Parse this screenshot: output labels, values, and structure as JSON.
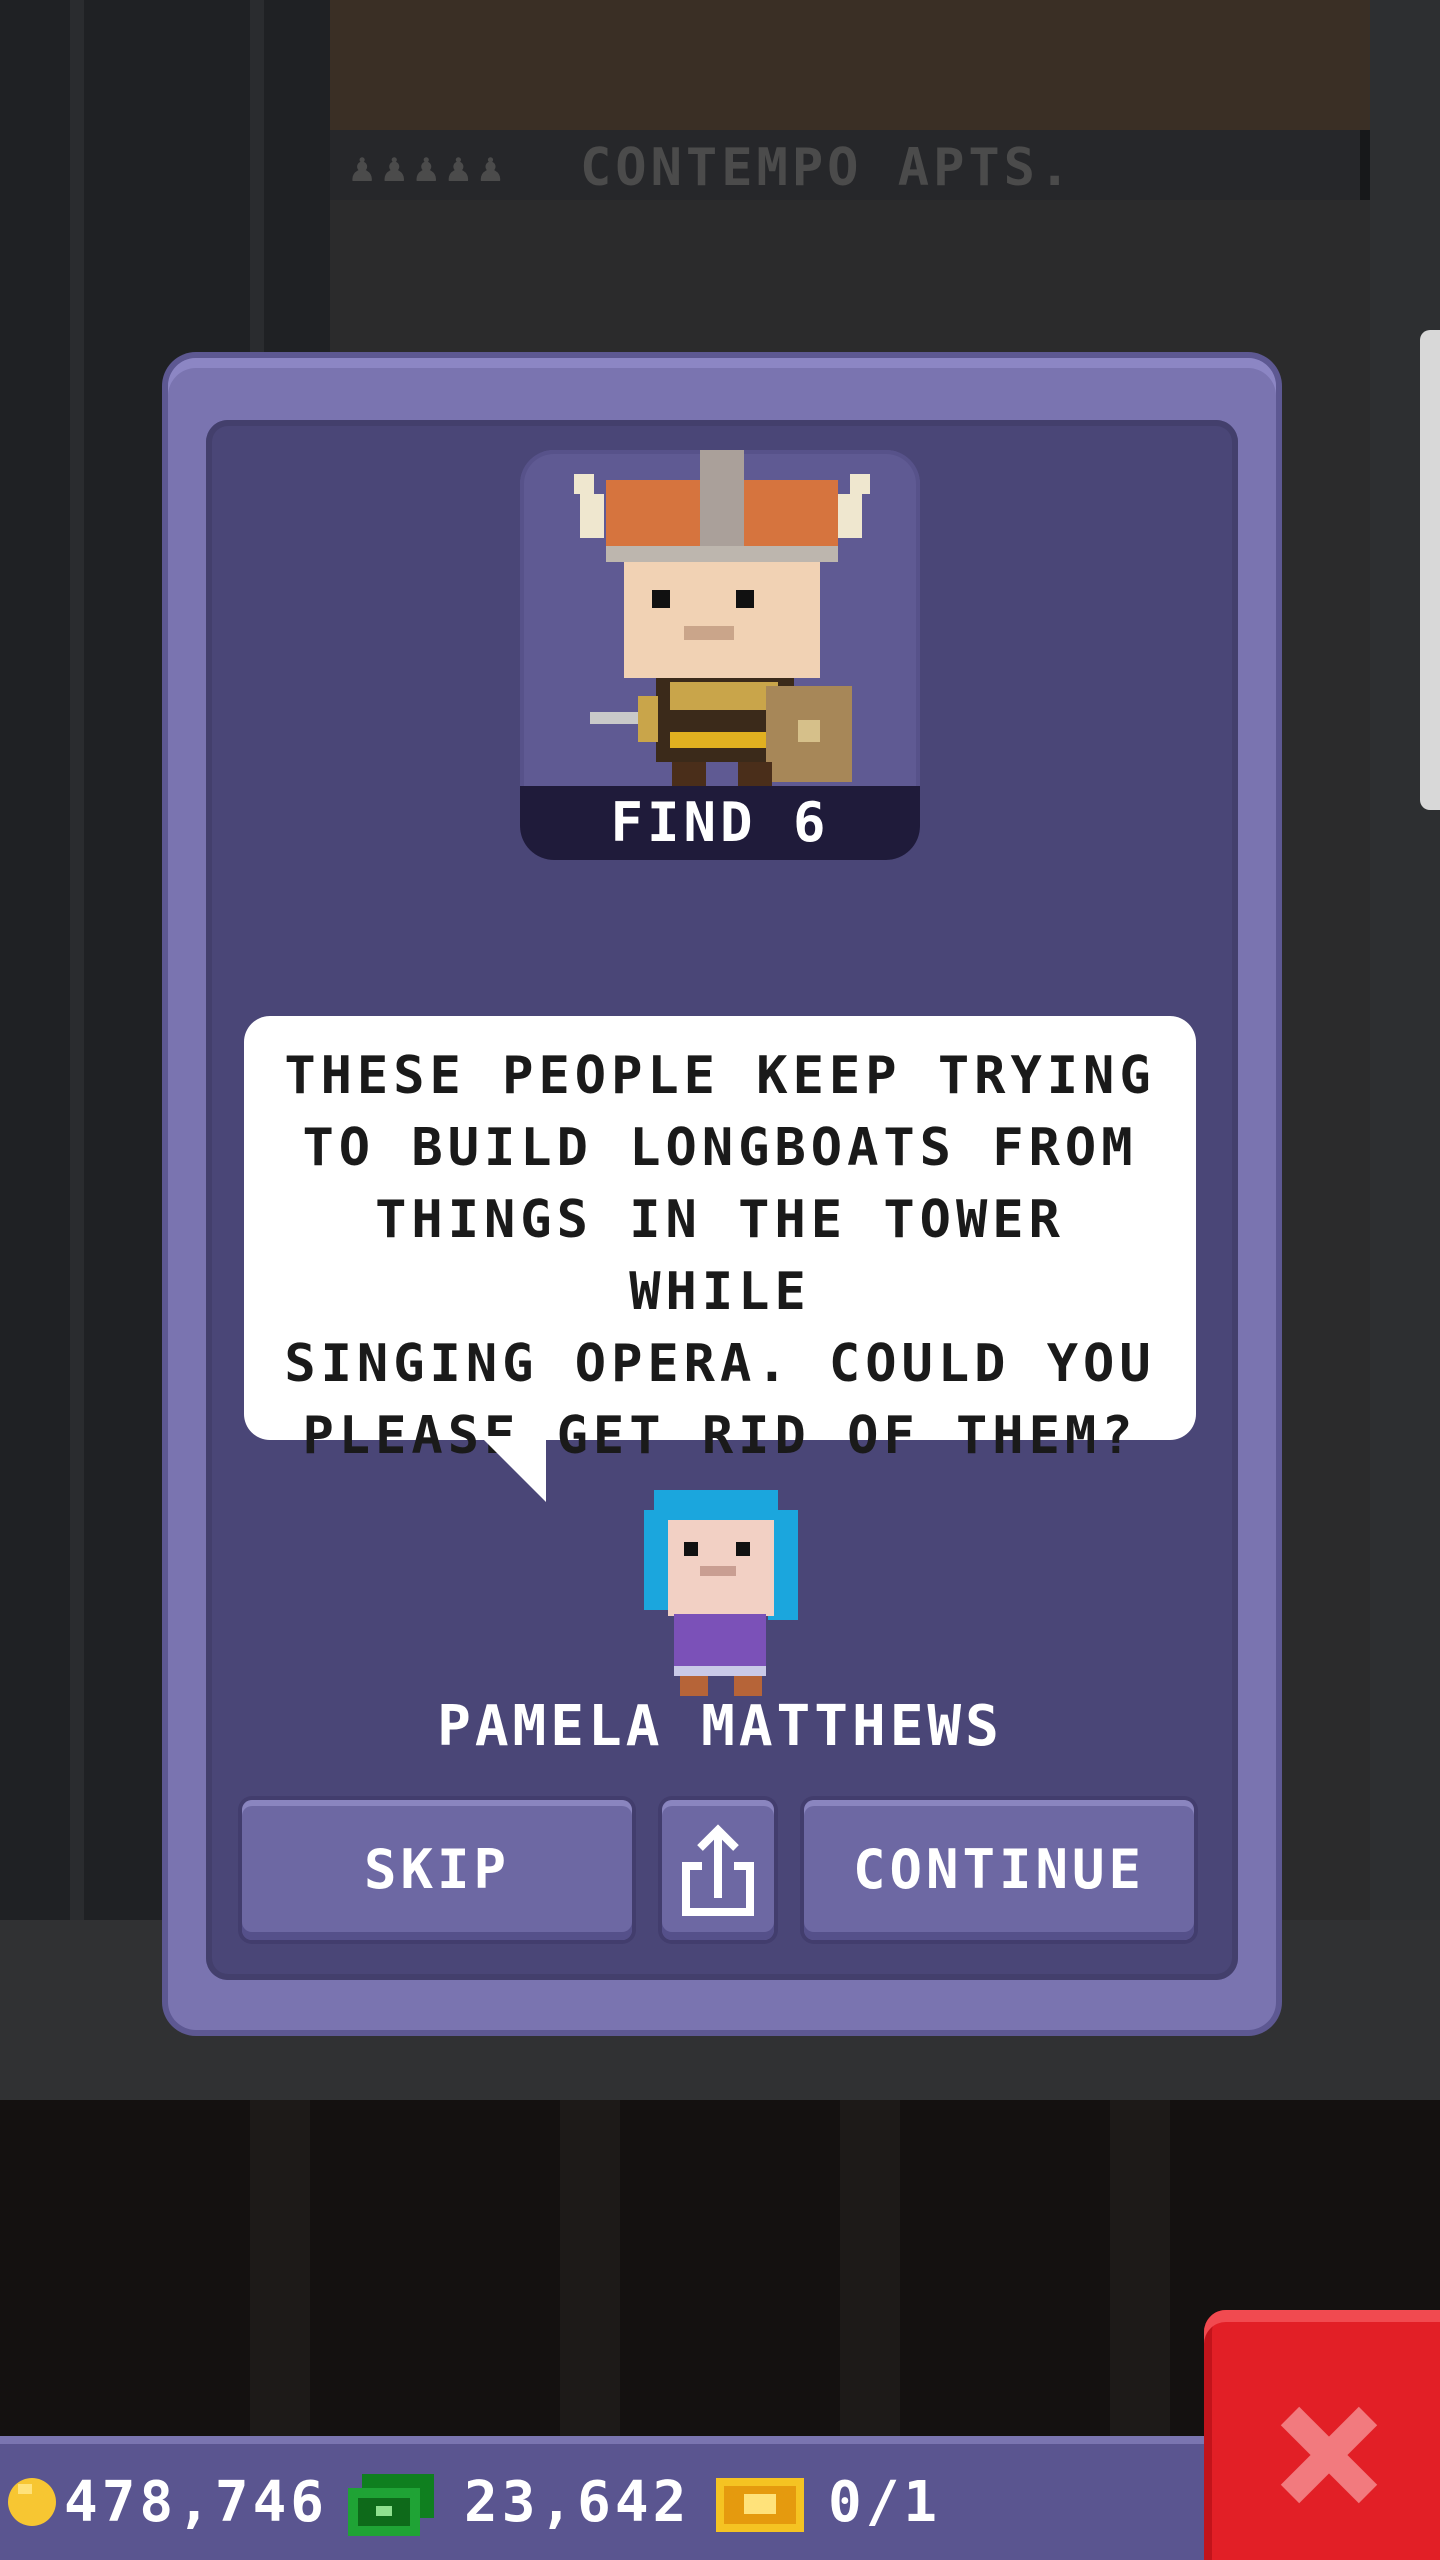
{
  "background": {
    "floor_sign": "CONTEMPO APTS.",
    "resident_icons": "♟♟♟♟♟"
  },
  "dialog": {
    "mission_label": "FIND 6",
    "message": "THESE PEOPLE KEEP TRYING\nTO BUILD LONGBOATS FROM\nTHINGS IN THE TOWER WHILE\nSINGING OPERA. COULD YOU\nPLEASE GET RID OF THEM?",
    "npc_name": "PAMELA MATTHEWS",
    "buttons": {
      "skip": "SKIP",
      "share_icon": "share-icon",
      "continue": "CONTINUE"
    }
  },
  "status_bar": {
    "coins": "478,746",
    "bux": "23,642",
    "tickets": "0/1"
  },
  "colors": {
    "dialog_frame": "#7a74b0",
    "dialog_inner": "#4a4677",
    "close_button": "#e21f26",
    "status_bar": "#5a5590"
  }
}
